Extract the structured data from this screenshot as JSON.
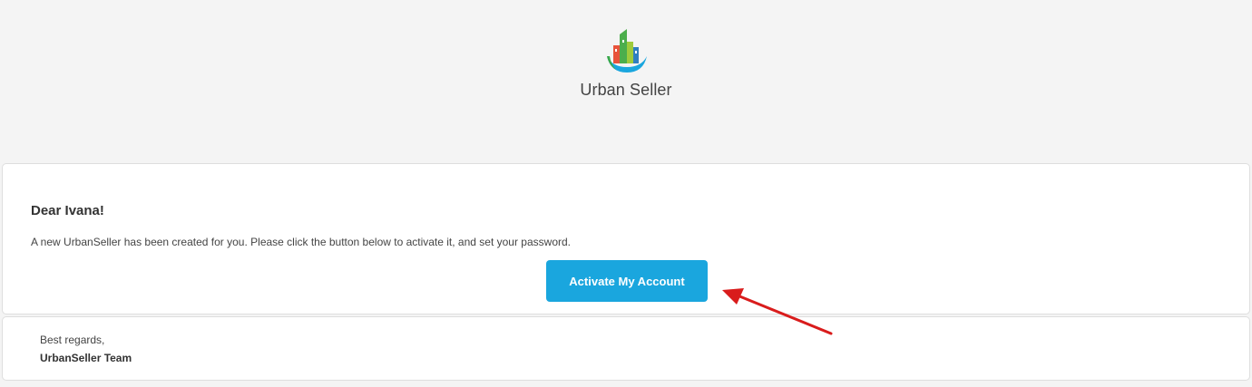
{
  "header": {
    "brand_name": "Urban Seller",
    "logo_icon": "urban-seller-buildings-logo-icon"
  },
  "email": {
    "greeting": "Dear Ivana!",
    "message": "A new UrbanSeller has been created for you. Please click the button below to activate it, and set your password.",
    "activate_button_label": "Activate My Account"
  },
  "footer": {
    "regards": "Best regards,",
    "team": "UrbanSeller Team"
  },
  "colors": {
    "background": "#f4f4f4",
    "button": "#1aa6de",
    "annotation_arrow": "#d91c1c"
  },
  "annotation": {
    "icon": "red-arrow-icon"
  }
}
